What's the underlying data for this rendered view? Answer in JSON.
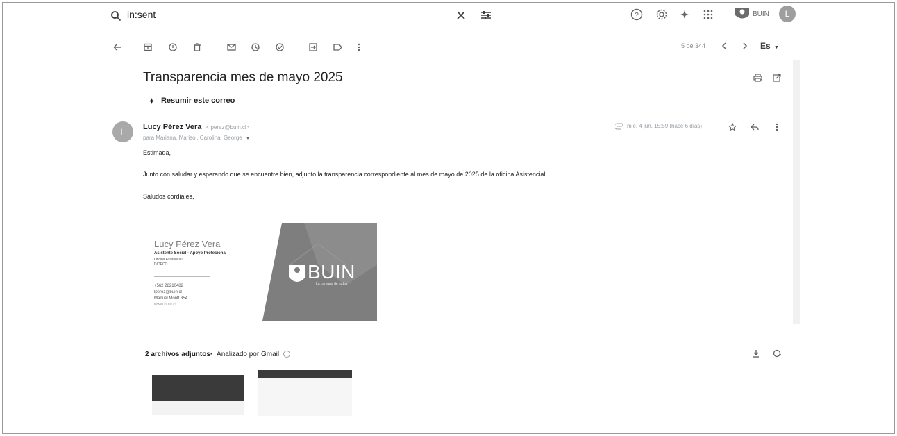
{
  "search": {
    "query": "in:sent"
  },
  "header": {
    "brand": "BUIN",
    "avatar": "L"
  },
  "toolbar": {
    "pager": "5 de 344",
    "lang": "Es"
  },
  "message": {
    "subject": "Transparencia mes de mayo 2025",
    "summarize": "Resumir este correo",
    "sender_name": "Lucy Pérez Vera",
    "sender_email": "<lperez@buin.cl>",
    "recipients": "para Mariana, Marisol, Carolina, George",
    "date": "mié, 4 jun, 15:59 (hace 6 días)",
    "avatar_letter": "L",
    "body": [
      "Estimada,",
      "Junto con saludar y esperando que se encuentre bien, adjunto la transparencia correspondiente al mes de mayo de 2025 de la oficina Asistencial.",
      "Saludos cordiales,"
    ]
  },
  "signature": {
    "name": "Lucy Pérez Vera",
    "role": "Asistente Social - Apoyo Profesional",
    "office": "Oficina Asistencial",
    "dept": "DIDECO",
    "phone": "+562 28210482",
    "email": "lperez@buin.cl",
    "address": "Manuel Montt 354",
    "web": "www.buin.cl",
    "banner_text": "BUIN",
    "banner_sub": "La comuna de todos"
  },
  "attachments": {
    "title": "2 archivos adjuntos",
    "scanned": "Analizado por Gmail"
  }
}
